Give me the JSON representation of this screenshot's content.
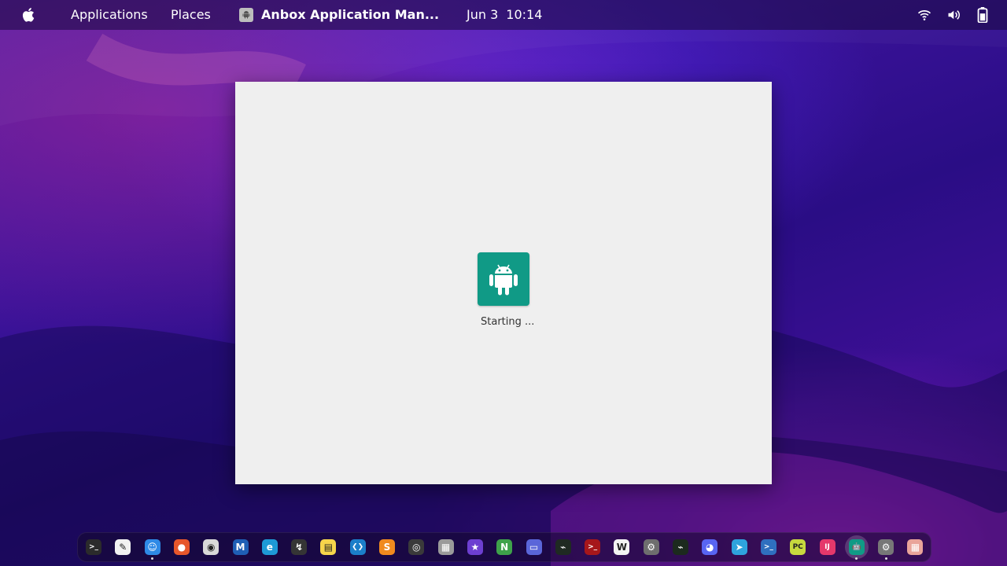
{
  "topbar": {
    "apple_icon": "apple-icon",
    "applications_label": "Applications",
    "places_label": "Places",
    "app_title": "Anbox Application Man...",
    "date": "Jun 3",
    "time": "10:14",
    "tray_icons": [
      "wifi-icon",
      "volume-icon",
      "battery-icon"
    ]
  },
  "window": {
    "splash_icon": "android-icon",
    "status_text": "Starting ...",
    "accent_color": "#109a86"
  },
  "dock": {
    "apps": [
      {
        "name": "terminal",
        "glyph": ">_",
        "color": "#2b2b2b"
      },
      {
        "name": "text-editor",
        "glyph": "✎",
        "color": "#f1f1f1"
      },
      {
        "name": "finder",
        "glyph": "☺",
        "color": "#2e8ae6"
      },
      {
        "name": "firefox",
        "glyph": "●",
        "color": "#e7572b"
      },
      {
        "name": "chrome",
        "glyph": "◉",
        "color": "#d9d9d9"
      },
      {
        "name": "mailspring",
        "glyph": "M",
        "color": "#1f5fb5"
      },
      {
        "name": "edge",
        "glyph": "e",
        "color": "#1e9ad6"
      },
      {
        "name": "sublime-merge",
        "glyph": "↯",
        "color": "#353535"
      },
      {
        "name": "notes",
        "glyph": "▤",
        "color": "#f7d54b"
      },
      {
        "name": "vscode",
        "glyph": "❮❯",
        "color": "#1b7ec9"
      },
      {
        "name": "sublime-text",
        "glyph": "S",
        "color": "#f08a1e"
      },
      {
        "name": "obs",
        "glyph": "◎",
        "color": "#3a3a3a"
      },
      {
        "name": "chess",
        "glyph": "▦",
        "color": "#9a9a9a"
      },
      {
        "name": "imovie",
        "glyph": "★",
        "color": "#6d3fd1"
      },
      {
        "name": "neovim",
        "glyph": "N",
        "color": "#3ea24a"
      },
      {
        "name": "screen-recorder",
        "glyph": "▭",
        "color": "#5a66d9"
      },
      {
        "name": "activity-monitor",
        "glyph": "⌁",
        "color": "#1f2a22"
      },
      {
        "name": "terminus",
        "glyph": ">_",
        "color": "#a6171b"
      },
      {
        "name": "wikipedia",
        "glyph": "W",
        "color": "#f3f3f3"
      },
      {
        "name": "settings",
        "glyph": "⚙",
        "color": "#6e6e6e"
      },
      {
        "name": "system-monitor",
        "glyph": "⌁",
        "color": "#1c2a1e"
      },
      {
        "name": "discord",
        "glyph": "◕",
        "color": "#5865f2"
      },
      {
        "name": "telegram",
        "glyph": "➤",
        "color": "#2ea3dd"
      },
      {
        "name": "powershell",
        "glyph": ">_",
        "color": "#2f6fbf"
      },
      {
        "name": "pycharm",
        "glyph": "PC",
        "color": "#c7d93e"
      },
      {
        "name": "intellij",
        "glyph": "IJ",
        "color": "#e5386b"
      },
      {
        "name": "anbox",
        "glyph": "🤖",
        "color": "#109a86"
      },
      {
        "name": "preferences",
        "glyph": "⚙",
        "color": "#777777"
      },
      {
        "name": "app-grid",
        "glyph": "▦",
        "color": "#e9a49a"
      }
    ]
  }
}
